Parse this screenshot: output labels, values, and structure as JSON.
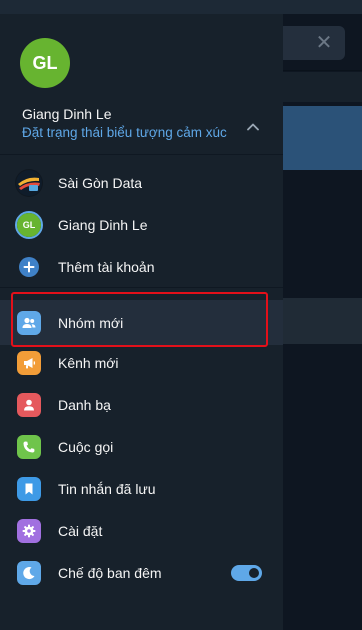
{
  "background": {
    "close_glyph": "✕"
  },
  "profile": {
    "initials": "GL",
    "name": "Giang Dinh Le",
    "status_link": "Đặt trạng thái biểu tượng cảm xúc"
  },
  "accounts": [
    {
      "label": "Sài Gòn Data",
      "icon": "saigon-data-logo"
    },
    {
      "label": "Giang Dinh Le",
      "initials": "GL",
      "icon": "avatar"
    },
    {
      "label": "Thêm tài khoản",
      "icon": "plus-icon"
    }
  ],
  "menu": [
    {
      "label": "Nhóm mới",
      "icon": "group-icon",
      "color": "#5fa8e8"
    },
    {
      "label": "Kênh mới",
      "icon": "megaphone-icon",
      "color": "#f29d38"
    },
    {
      "label": "Danh bạ",
      "icon": "contact-icon",
      "color": "#e5595d"
    },
    {
      "label": "Cuộc gọi",
      "icon": "phone-icon",
      "color": "#6fc44b"
    },
    {
      "label": "Tin nhắn đã lưu",
      "icon": "bookmark-icon",
      "color": "#3e9ae6"
    },
    {
      "label": "Cài đặt",
      "icon": "gear-icon",
      "color": "#a170e0"
    },
    {
      "label": "Chế độ ban đêm",
      "icon": "moon-icon",
      "color": "#5fa8e8",
      "toggle_on": true
    }
  ],
  "colors": {
    "drawer_bg": "#17212b",
    "accent": "#5fa8e8",
    "highlight": "#e3101a"
  }
}
